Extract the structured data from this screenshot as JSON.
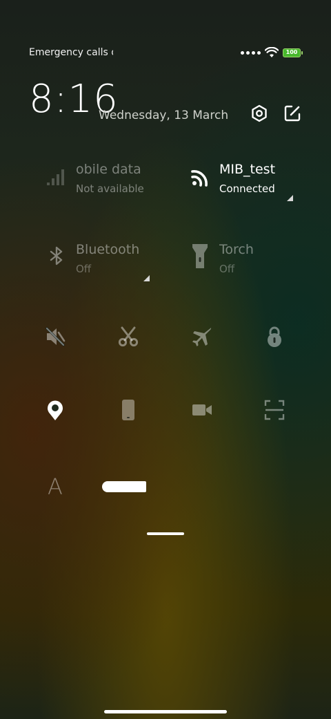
{
  "status_bar": {
    "carrier_text": "Emergency calls o",
    "battery_level": "100",
    "battery_color": "#48b82d"
  },
  "header": {
    "time": "8:16",
    "date": "Wednesday, 13 March",
    "icons": [
      "settings-icon",
      "edit-icon"
    ]
  },
  "tiles": {
    "mobile_data": {
      "title": "obile data",
      "subtitle": "Not available",
      "icon": "signal-bars-icon",
      "active": false
    },
    "wifi": {
      "title": "MIB_test",
      "subtitle": "Connected",
      "icon": "wifi-icon",
      "active": true
    },
    "bluetooth": {
      "title": "Bluetooth",
      "subtitle": "Off",
      "icon": "bluetooth-icon",
      "active": false
    },
    "torch": {
      "title": "Torch",
      "subtitle": "Off",
      "icon": "torch-icon",
      "active": false
    }
  },
  "toggles_row1": [
    {
      "name": "mute-toggle",
      "icon": "speaker-mute-icon",
      "active": false
    },
    {
      "name": "screenshot-toggle",
      "icon": "scissors-icon",
      "active": false
    },
    {
      "name": "airplane-toggle",
      "icon": "airplane-icon",
      "active": false
    },
    {
      "name": "lock-toggle",
      "icon": "lock-icon",
      "active": false
    }
  ],
  "toggles_row2": [
    {
      "name": "location-toggle",
      "icon": "location-pin-icon",
      "active": true
    },
    {
      "name": "rotation-toggle",
      "icon": "phone-icon",
      "active": false
    },
    {
      "name": "screen-record-toggle",
      "icon": "video-camera-icon",
      "active": false
    },
    {
      "name": "scanner-toggle",
      "icon": "scan-frame-icon",
      "active": false
    }
  ],
  "toggles_row3": {
    "font_label": "A",
    "font_icon": "font-size-icon"
  }
}
